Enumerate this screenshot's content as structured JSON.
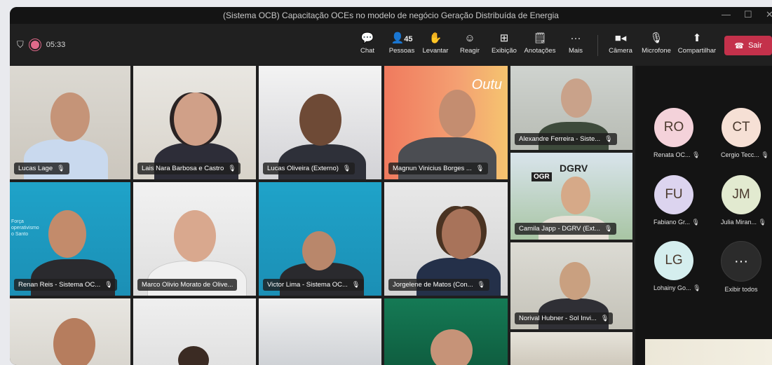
{
  "window": {
    "title": "(Sistema OCB) Capacitação OCEs no modelo de negócio Geração Distribuída de Energia"
  },
  "toolbar": {
    "timer": "05:33",
    "buttons": [
      {
        "label": "Chat",
        "icon": "chat-icon"
      },
      {
        "label": "Pessoas",
        "icon": "people-icon",
        "count": "45"
      },
      {
        "label": "Levantar",
        "icon": "raise-hand-icon"
      },
      {
        "label": "Reagir",
        "icon": "react-icon"
      },
      {
        "label": "Exibição",
        "icon": "view-icon"
      },
      {
        "label": "Anotações",
        "icon": "notes-icon"
      },
      {
        "label": "Mais",
        "icon": "more-icon"
      },
      {
        "label": "Câmera",
        "icon": "camera-icon"
      },
      {
        "label": "Microfone",
        "icon": "mic-off-icon"
      },
      {
        "label": "Compartilhar",
        "icon": "share-icon"
      }
    ],
    "leave_label": "Sair"
  },
  "tiles": [
    {
      "name": "Lucas Lage"
    },
    {
      "name": "Lais Nara Barbosa e Castro"
    },
    {
      "name": "Lucas Oliveira (Externo)"
    },
    {
      "name": "Magnun Vinicius Borges ..."
    },
    {
      "name": "Alexandre Ferreira - Siste..."
    },
    {
      "name": "Camila Japp - DGRV (Ext..."
    },
    {
      "name": "Renan Reis - Sistema OC..."
    },
    {
      "name": "Marco Olivio Morato de Olive..."
    },
    {
      "name": "Victor Lima - Sistema OC..."
    },
    {
      "name": "Jorgelene de Matos (Con..."
    },
    {
      "name": "Norival Hubner - Sol Invi..."
    }
  ],
  "tile_texts": {
    "dgrv": "DGRV",
    "ogr": "OGR",
    "outu": "Outu",
    "forca": "Força",
    "cooperativismo": "operativismo",
    "santo": "o Santo"
  },
  "sidebar": {
    "participants": [
      {
        "initials": "RO",
        "name": "Renata OC...",
        "color": "#f4d2da"
      },
      {
        "initials": "CT",
        "name": "Cergio Tecc...",
        "color": "#f6e0d5"
      },
      {
        "initials": "FU",
        "name": "Fabiano Gr...",
        "color": "#dcd4ef"
      },
      {
        "initials": "JM",
        "name": "Julia Miran...",
        "color": "#e2ead0"
      },
      {
        "initials": "LG",
        "name": "Lohainy Go...",
        "color": "#d5eeee"
      }
    ],
    "more_label": "Exibir todos",
    "more_glyph": "···"
  }
}
